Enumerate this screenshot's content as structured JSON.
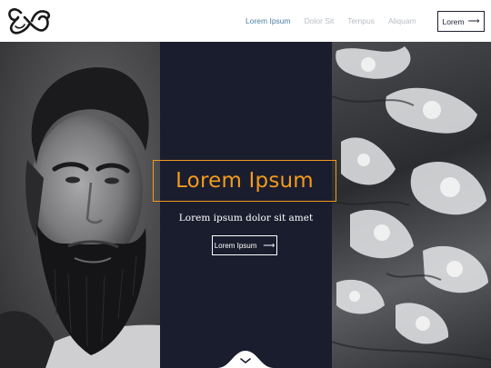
{
  "header": {
    "logo_icon": "ampersand-logo",
    "nav": [
      {
        "label": "Lorem Ipsum",
        "active": true
      },
      {
        "label": "Dolor Sit",
        "active": false
      },
      {
        "label": "Tempus",
        "active": false
      },
      {
        "label": "Aliquam",
        "active": false
      }
    ],
    "cta_label": "Lorem",
    "cta_icon": "arrow-right-icon"
  },
  "hero": {
    "title": "Lorem Ipsum",
    "subtitle": "Lorem ipsum dolor sit amet",
    "button_label": "Lorem Ipsum",
    "button_icon": "arrow-right-icon",
    "scroll_icon": "chevron-down-icon",
    "left_image": "bearded-man-portrait",
    "right_image": "ocean-waves"
  },
  "colors": {
    "accent": "#f29a1e",
    "nav_active": "#4a7fa4",
    "nav_inactive": "#b8bcc2",
    "dark_panel": "#1a1d2e",
    "header_bg": "#ffffff"
  }
}
